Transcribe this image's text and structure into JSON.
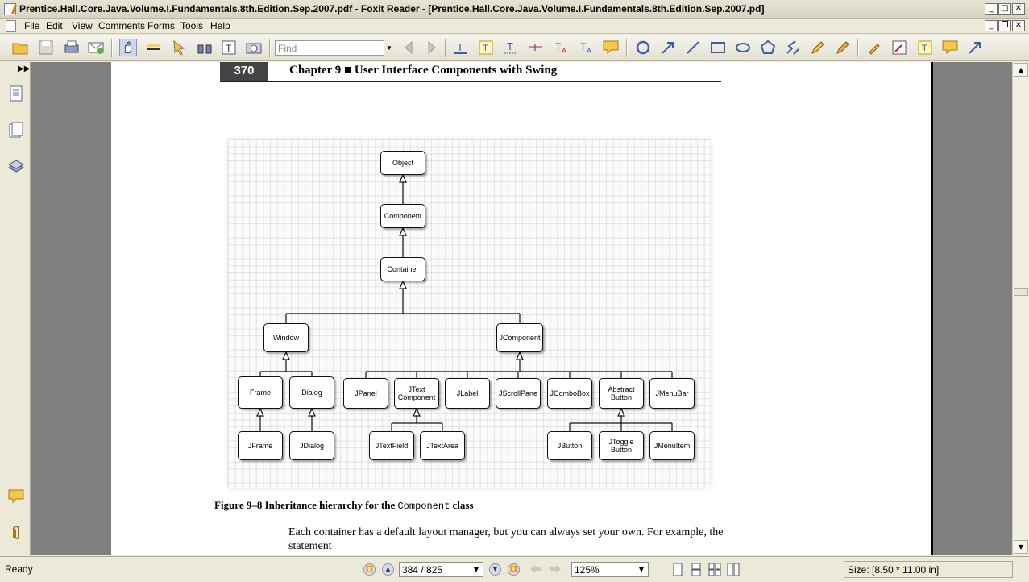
{
  "window": {
    "title": "Prentice.Hall.Core.Java.Volume.I.Fundamentals.8th.Edition.Sep.2007.pdf - Foxit Reader - [Prentice.Hall.Core.Java.Volume.I.Fundamentals.8th.Edition.Sep.2007.pd]"
  },
  "menu": [
    "File",
    "Edit",
    "View",
    "Comments",
    "Forms",
    "Tools",
    "Help"
  ],
  "toolbar": {
    "find_placeholder": "Find"
  },
  "page": {
    "number": "370",
    "chapter_header": "Chapter 9 ■ User Interface Components with Swing",
    "figure": {
      "caption_prefix": "Figure 9–8  Inheritance hierarchy for the ",
      "caption_code": "Component",
      "caption_suffix": " class",
      "nodes": {
        "object": "Object",
        "component": "Component",
        "container": "Container",
        "window": "Window",
        "jcomponent": "JComponent",
        "frame": "Frame",
        "dialog": "Dialog",
        "jpanel": "JPanel",
        "jtextcomponent": "JText Component",
        "jlabel": "JLabel",
        "jscrollpane": "JScrollPane",
        "jcombobox": "JComboBox",
        "abstractbutton": "Abstract Button",
        "jmenubar": "JMenuBar",
        "jframe": "JFrame",
        "jdialog": "JDialog",
        "jtextfield": "JTextField",
        "jtextarea": "JTextArea",
        "jbutton": "JButton",
        "jtogglebutton": "JToggle Button",
        "jmenuitem": "JMenuItem"
      }
    },
    "body_text": "Each container has a default layout manager, but you can always set your own. For example, the statement"
  },
  "status": {
    "ready": "Ready",
    "page_indicator": "384 / 825",
    "zoom": "125%",
    "size": "Size: [8.50 * 11.00 in]"
  },
  "colors": {
    "viewport_bg": "#808080",
    "chrome_bg": "#ece9d8"
  }
}
